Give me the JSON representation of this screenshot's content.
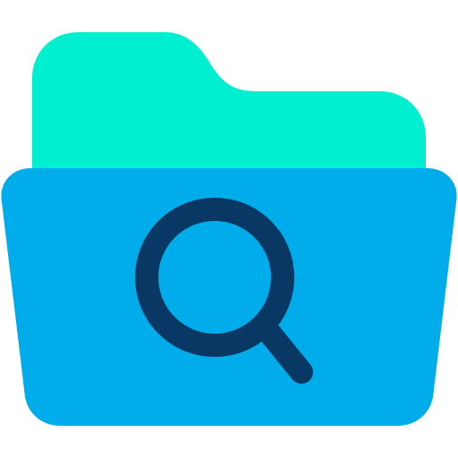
{
  "icon": {
    "name": "folder-search-icon",
    "parts": {
      "folder_back": "folder-back-icon",
      "folder_front": "folder-front-icon",
      "magnifier": "magnifying-glass-icon"
    }
  },
  "colors": {
    "folder_back": "#00EFD1",
    "folder_front": "#00ACEA",
    "magnifier": "#083863",
    "background": "#FFFFFF"
  }
}
